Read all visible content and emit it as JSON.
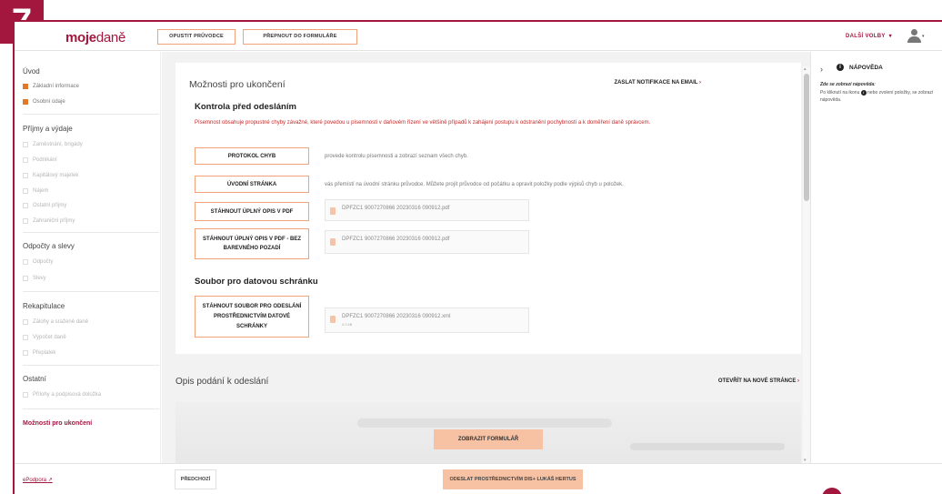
{
  "badge": "7",
  "header": {
    "logo_moje": "moje",
    "logo_dane": "daně",
    "btn_exit": "OPUSTIT PRŮVODCE",
    "btn_switch": "PŘEPNOUT DO FORMULÁŘE",
    "more": "DALŠÍ VOLBY"
  },
  "sidebar": {
    "s1": "Úvod",
    "s1_items": [
      "Základní informace",
      "Osobní údaje"
    ],
    "s2": "Příjmy a výdaje",
    "s2_items": [
      "Zaměstnání, brigády",
      "Podnikání",
      "Kapitálový majetek",
      "Nájem",
      "Ostatní příjmy",
      "Zahraniční příjmy"
    ],
    "s3": "Odpočty a slevy",
    "s3_items": [
      "Odpočty",
      "Slevy"
    ],
    "s4": "Rekapitulace",
    "s4_items": [
      "Zálohy a sražené daně",
      "Výpočet daně",
      "Přeplatek"
    ],
    "s5": "Ostatní",
    "s5_items": [
      "Přílohy a podpisová doložka"
    ],
    "active": "Možnosti pro ukončení"
  },
  "main": {
    "title": "Možnosti pro ukončení",
    "notify": "ZASLAT NOTIFIKACE NA EMAIL",
    "check_title": "Kontrola před odesláním",
    "warning": "Písemnost obsahuje propustné chyby závažné, které povedou u písemnosti v daňovém řízení ve většině případů k zahájení postupu k odstranění pochybností a k doměření daně správcem.",
    "actions": [
      {
        "label": "PROTOKOL CHYB",
        "desc": "provede kontrolu písemnosti a zobrazí seznam všech chyb."
      },
      {
        "label": "ÚVODNÍ STRÁNKA",
        "desc": "vás přemístí na úvodní stránku průvodce. Můžete projít průvodce od počátku a opravit položky podle výpisů chyb u položek."
      },
      {
        "label": "STÁHNOUT ÚPLNÝ OPIS V PDF",
        "file": "DPFZC1 9007270866 20230316 090912.pdf"
      },
      {
        "label": "STÁHNOUT ÚPLNÝ OPIS V PDF - BEZ BAREVNÉHO POZADÍ",
        "file": "DPFZC1 9007270866 20230316 090912.pdf"
      }
    ],
    "databox_title": "Soubor pro datovou schránku",
    "databox_btn": "STÁHNOUT SOUBOR PRO ODESLÁNÍ PROSTŘEDNICTVÍM DATOVÉ SCHRÁNKY",
    "databox_file": "DPFZC1 9007270866 20230316 090912.xml",
    "databox_size": "0.0 kB",
    "preview_title": "Opis podání k odeslání",
    "open_new": "OTEVŘÍT NA NOVÉ STRÁNCE",
    "show_form": "ZOBRAZIT FORMULÁŘ"
  },
  "help": {
    "title": "NÁPOVĚDA",
    "label": "Zde se zobrazí nápověda:",
    "desc_a": "Po kliknutí na ikonu",
    "desc_b": "nebo zvolení položky, se zobrazí nápověda."
  },
  "footer": {
    "podpora": "ePodpora",
    "prev": "PŘEDCHOZÍ",
    "send": "ODESLAT PROSTŘEDNICTVÍM DIS+ LUKÁŠ HERTUS"
  }
}
